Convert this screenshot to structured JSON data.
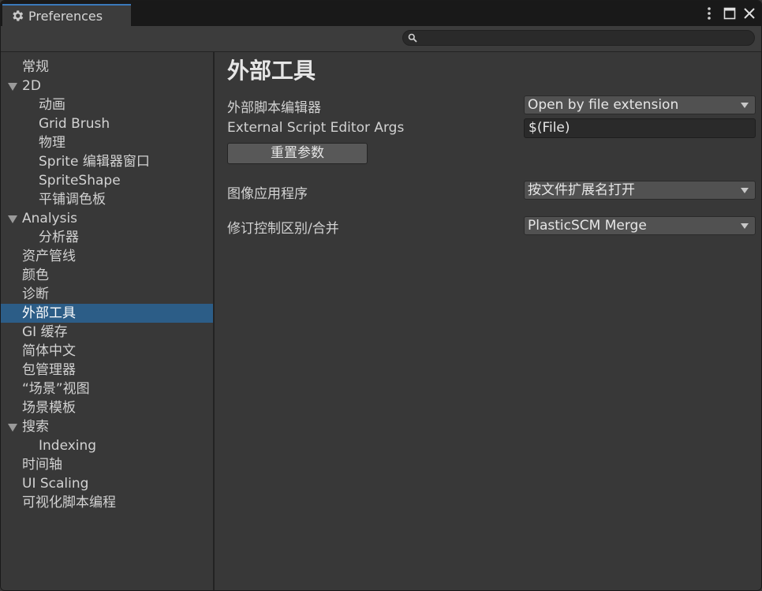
{
  "window": {
    "title": "Preferences"
  },
  "search": {
    "value": "",
    "placeholder": ""
  },
  "sidebar": {
    "items": [
      {
        "label": "常规",
        "level": 0,
        "expandable": false,
        "selected": false
      },
      {
        "label": "2D",
        "level": 0,
        "expandable": true,
        "selected": false
      },
      {
        "label": "动画",
        "level": 1,
        "expandable": false,
        "selected": false
      },
      {
        "label": "Grid Brush",
        "level": 1,
        "expandable": false,
        "selected": false
      },
      {
        "label": "物理",
        "level": 1,
        "expandable": false,
        "selected": false
      },
      {
        "label": "Sprite 编辑器窗口",
        "level": 1,
        "expandable": false,
        "selected": false
      },
      {
        "label": "SpriteShape",
        "level": 1,
        "expandable": false,
        "selected": false
      },
      {
        "label": "平铺调色板",
        "level": 1,
        "expandable": false,
        "selected": false
      },
      {
        "label": "Analysis",
        "level": 0,
        "expandable": true,
        "selected": false
      },
      {
        "label": "分析器",
        "level": 1,
        "expandable": false,
        "selected": false
      },
      {
        "label": "资产管线",
        "level": 0,
        "expandable": false,
        "selected": false
      },
      {
        "label": "颜色",
        "level": 0,
        "expandable": false,
        "selected": false
      },
      {
        "label": "诊断",
        "level": 0,
        "expandable": false,
        "selected": false
      },
      {
        "label": "外部工具",
        "level": 0,
        "expandable": false,
        "selected": true
      },
      {
        "label": "GI 缓存",
        "level": 0,
        "expandable": false,
        "selected": false
      },
      {
        "label": "简体中文",
        "level": 0,
        "expandable": false,
        "selected": false
      },
      {
        "label": "包管理器",
        "level": 0,
        "expandable": false,
        "selected": false
      },
      {
        "label": "“场景”视图",
        "level": 0,
        "expandable": false,
        "selected": false
      },
      {
        "label": "场景模板",
        "level": 0,
        "expandable": false,
        "selected": false
      },
      {
        "label": "搜索",
        "level": 0,
        "expandable": true,
        "selected": false
      },
      {
        "label": "Indexing",
        "level": 1,
        "expandable": false,
        "selected": false
      },
      {
        "label": "时间轴",
        "level": 0,
        "expandable": false,
        "selected": false
      },
      {
        "label": "UI Scaling",
        "level": 0,
        "expandable": false,
        "selected": false
      },
      {
        "label": "可视化脚本编程",
        "level": 0,
        "expandable": false,
        "selected": false
      }
    ]
  },
  "main": {
    "title": "外部工具",
    "external_script_editor": {
      "label": "外部脚本编辑器",
      "value": "Open by file extension"
    },
    "external_script_editor_args": {
      "label": "External Script Editor Args",
      "value": "$(File)"
    },
    "reset_button": {
      "label": "重置参数"
    },
    "image_application": {
      "label": "图像应用程序",
      "value": "按文件扩展名打开"
    },
    "revision_control_diff": {
      "label": "修订控制区别/合并",
      "value": "PlasticSCM Merge"
    }
  },
  "colors": {
    "background": "#383838",
    "titlebar": "#191919",
    "selection": "#2c5d87",
    "accent": "#3a79bb"
  },
  "icons": [
    "gear-icon",
    "kebab-menu-icon",
    "maximize-icon",
    "close-icon",
    "search-icon",
    "expand-arrow-icon",
    "dropdown-caret-icon"
  ]
}
